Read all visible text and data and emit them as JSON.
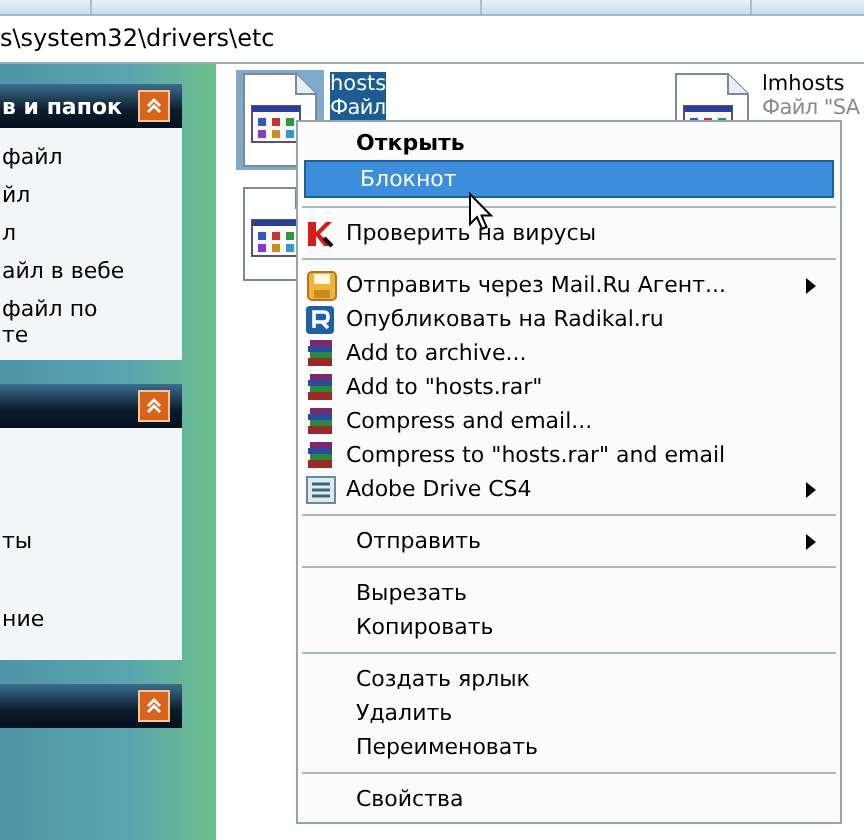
{
  "address": {
    "path": "s\\system32\\drivers\\etc"
  },
  "side_panels": [
    {
      "title": "в и папок",
      "expanded": true,
      "items": [
        {
          "lines": [
            "файл"
          ]
        },
        {
          "lines": [
            "йл"
          ]
        },
        {
          "lines": [
            "л"
          ]
        },
        {
          "lines": [
            "айл в вебе"
          ]
        },
        {
          "lines": [
            "файл по",
            "те"
          ]
        }
      ]
    },
    {
      "expanded": true,
      "items": [
        {
          "lines": [
            "ты"
          ]
        },
        {
          "lines": [
            "ние"
          ]
        }
      ]
    },
    {
      "expanded": true
    }
  ],
  "files": [
    {
      "name": "hosts",
      "type": "Файл",
      "selected": true
    },
    {
      "selected": false
    },
    {
      "name": "lmhosts",
      "type": "Файл \"SA",
      "selected": false
    }
  ],
  "context_menu": [
    {
      "kind": "item",
      "label": "Открыть",
      "bold": true,
      "selected": false,
      "submenu": false
    },
    {
      "kind": "item",
      "label": "Блокнот",
      "bold": false,
      "selected": true,
      "submenu": false
    },
    {
      "kind": "separator"
    },
    {
      "kind": "item",
      "label": "Проверить на вирусы",
      "bold": false,
      "selected": false,
      "submenu": false
    },
    {
      "kind": "separator"
    },
    {
      "kind": "item",
      "label": "Отправить через Mail.Ru Агент...",
      "bold": false,
      "selected": false,
      "submenu": true
    },
    {
      "kind": "item",
      "label": "Опубликовать на Radikal.ru",
      "bold": false,
      "selected": false,
      "submenu": false
    },
    {
      "kind": "item",
      "label": "Add to archive...",
      "bold": false,
      "selected": false,
      "submenu": false
    },
    {
      "kind": "item",
      "label": "Add to \"hosts.rar\"",
      "bold": false,
      "selected": false,
      "submenu": false
    },
    {
      "kind": "item",
      "label": "Compress and email...",
      "bold": false,
      "selected": false,
      "submenu": false
    },
    {
      "kind": "item",
      "label": "Compress to \"hosts.rar\" and email",
      "bold": false,
      "selected": false,
      "submenu": false
    },
    {
      "kind": "item",
      "label": "Adobe Drive CS4",
      "bold": false,
      "selected": false,
      "submenu": true
    },
    {
      "kind": "separator"
    },
    {
      "kind": "item",
      "label": "Отправить",
      "bold": false,
      "selected": false,
      "submenu": true
    },
    {
      "kind": "separator"
    },
    {
      "kind": "item",
      "label": "Вырезать",
      "bold": false,
      "selected": false,
      "submenu": false
    },
    {
      "kind": "item",
      "label": "Копировать",
      "bold": false,
      "selected": false,
      "submenu": false
    },
    {
      "kind": "separator"
    },
    {
      "kind": "item",
      "label": "Создать ярлык",
      "bold": false,
      "selected": false,
      "submenu": false
    },
    {
      "kind": "item",
      "label": "Удалить",
      "bold": false,
      "selected": false,
      "submenu": false
    },
    {
      "kind": "item",
      "label": "Переименовать",
      "bold": false,
      "selected": false,
      "submenu": false
    },
    {
      "kind": "separator"
    },
    {
      "kind": "item",
      "label": "Свойства",
      "bold": false,
      "selected": false,
      "submenu": false
    }
  ]
}
